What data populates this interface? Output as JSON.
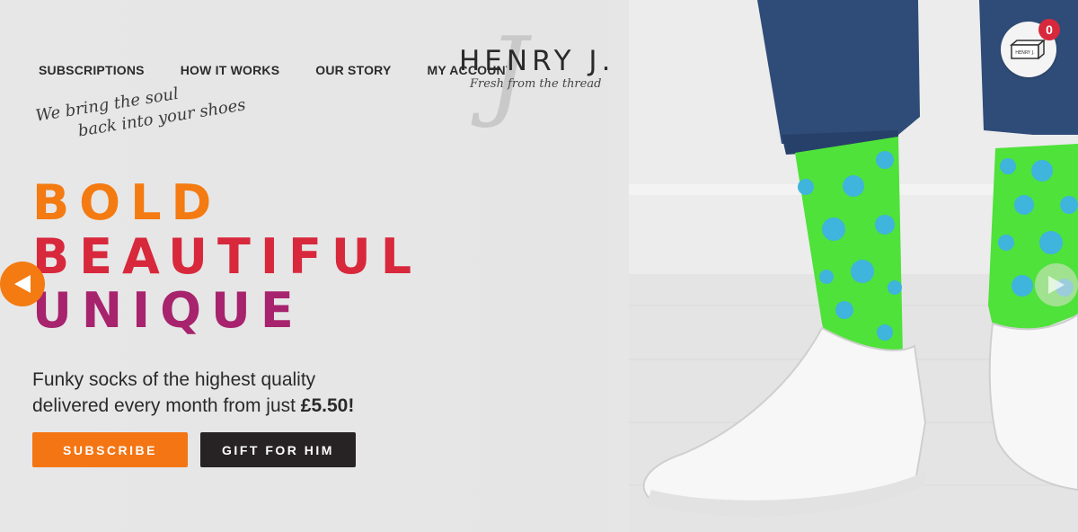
{
  "brand": {
    "name": "HENRY J.",
    "monogram": "J",
    "tagline": "Fresh from the thread"
  },
  "nav": {
    "items": [
      {
        "label": "SUBSCRIPTIONS"
      },
      {
        "label": "HOW IT WORKS"
      },
      {
        "label": "OUR STORY"
      },
      {
        "label": "MY ACCOUNT"
      }
    ]
  },
  "cart": {
    "count": "0",
    "box_label": "HENRY J."
  },
  "hero": {
    "tagline_line1": "We bring the soul",
    "tagline_line2": "back into your shoes",
    "headline": [
      "BOLD",
      "BEAUTIFUL",
      "UNIQUE"
    ],
    "subtext_line1": "Funky socks of the highest quality",
    "subtext_line2": "delivered every month from just ",
    "price": "£5.50!",
    "buttons": {
      "subscribe": "SUBSCRIBE",
      "gift": "GIFT FOR HIM"
    }
  },
  "colors": {
    "orange": "#f47a12",
    "red": "#d8283c",
    "magenta": "#a7236d",
    "dark": "#272324"
  },
  "icons": {
    "prev": "arrow-left-icon",
    "next": "arrow-right-icon",
    "cart": "cart-box-icon"
  }
}
